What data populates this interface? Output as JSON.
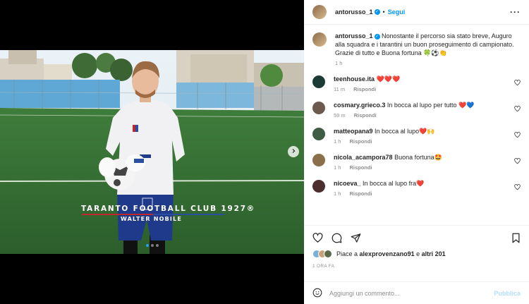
{
  "post": {
    "username": "antorusso_1",
    "follow_label": "Segui",
    "caption": "Nonostante il percorso sia stato breve, Auguro alla squadra e i tarantini un buon proseguimento di campionato. Grazie di tutto e Buona fortuna 🍀⚽👏",
    "caption_time": "1 h",
    "overlay_title": "TARANTO FOOTBALL CLUB 1927®",
    "overlay_subtitle": "WALTER NOBILE"
  },
  "comments": [
    {
      "user": "teenhouse.ita",
      "text": "❤️❤️❤️",
      "time": "11 m",
      "reply": "Rispondi",
      "avatar_color": "#1b3b34"
    },
    {
      "user": "cosmary.grieco.3",
      "text": "In bocca al lupo per tutto ❤️💙",
      "time": "59 m",
      "reply": "Rispondi",
      "avatar_color": "#6d5a4e"
    },
    {
      "user": "matteopana9",
      "text": "In bocca al lupo❤️🙌",
      "time": "1 h",
      "reply": "Rispondi",
      "avatar_color": "#3f5d44"
    },
    {
      "user": "nicola_acampora78",
      "text": "Buona fortuna🤩",
      "time": "1 h",
      "reply": "Rispondi",
      "avatar_color": "#8a6f4a"
    },
    {
      "user": "nicoeva_",
      "text": "In bocca al lupo fra❤️",
      "time": "1 h",
      "reply": "Rispondi",
      "avatar_color": "#4d2e2e"
    }
  ],
  "likes": {
    "prefix": "Piace a ",
    "user": "alexprovenzano91",
    "mid": " e ",
    "others": "altri 201"
  },
  "timestamp": "1 ORA FA",
  "composer": {
    "placeholder": "Aggiungi un commento...",
    "post_label": "Pubblica"
  },
  "icons": [
    "more-icon",
    "heart-icon",
    "comment-icon",
    "share-icon",
    "bookmark-icon",
    "emoji-icon",
    "chevron-right-icon",
    "verified-icon"
  ],
  "colors": {
    "accent": "#0095f6",
    "verified": "#0095f6",
    "muted": "#8e8e8e"
  }
}
